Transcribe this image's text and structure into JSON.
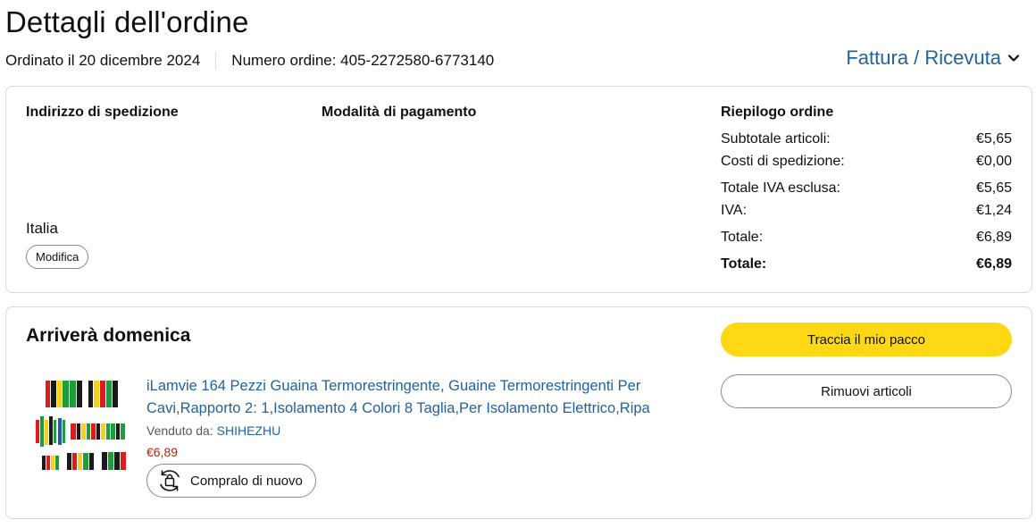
{
  "header": {
    "title": "Dettagli dell'ordine",
    "ordered_on": "Ordinato il 20 dicembre 2024",
    "order_number": "Numero ordine: 405-2272580-6773140",
    "invoice_link": "Fattura / Ricevuta",
    "invoice_icon": "chevron-down-icon"
  },
  "shipping": {
    "heading": "Indirizzo di spedizione",
    "country": "Italia",
    "edit_label": "Modifica"
  },
  "payment": {
    "heading": "Modalità di pagamento"
  },
  "summary": {
    "heading": "Riepilogo ordine",
    "rows": [
      {
        "label": "Subtotale articoli:",
        "value": "€5,65"
      },
      {
        "label": "Costi di spedizione:",
        "value": "€0,00"
      },
      {
        "label": "Totale IVA esclusa:",
        "value": "€5,65"
      },
      {
        "label": "IVA:",
        "value": "€1,24"
      },
      {
        "label": "Totale:",
        "value": "€6,89"
      },
      {
        "label": "Totale:",
        "value": "€6,89"
      }
    ]
  },
  "shipment": {
    "arrival": "Arriverà domenica",
    "track_label": "Traccia il mio pacco",
    "remove_label": "Rimuovi articoli",
    "track_color": "#ffd814",
    "product": {
      "title": "iLamvie 164 Pezzi Guaina Termorestringente, Guaine Termorestringenti Per Cavi,Rapporto 2: 1,Isolamento 4 Colori 8 Taglia,Per Isolamento Elettrico,Ripa",
      "sold_by_label": "Venduto da:",
      "seller": "SHIHEZHU",
      "price": "€6,89",
      "buy_again_label": "Compralo di nuovo",
      "buy_again_icon": "buy-again-icon",
      "image_colors": [
        "#1a1a1a",
        "#e01b1b",
        "#f2d21b",
        "#1d9e3a",
        "#2a55b5"
      ]
    }
  },
  "colors": {
    "link": "#2162a1",
    "price": "#b12704",
    "border": "#d5d9d9"
  }
}
